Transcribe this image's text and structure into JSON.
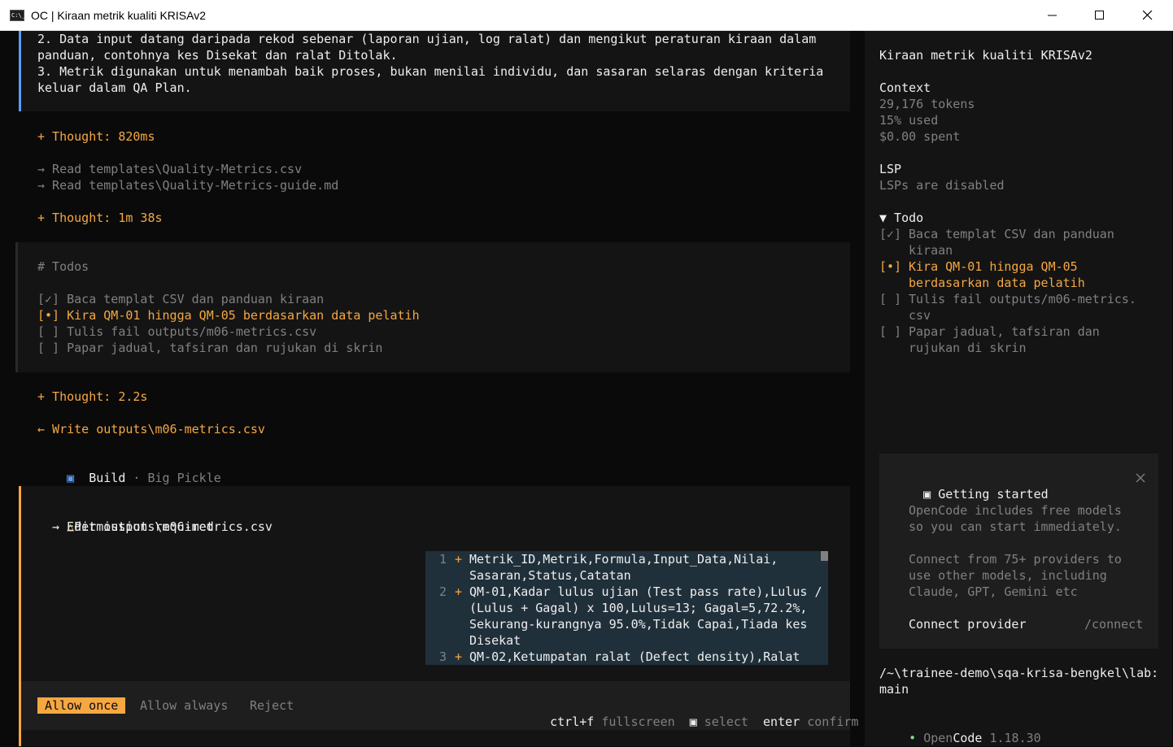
{
  "window": {
    "icon_text": "C:\\_",
    "title": "OC | Kiraan metrik kualiti KRISAv2"
  },
  "main": {
    "intro_lines": [
      "2. Data input datang daripada rekod sebenar (laporan ujian, log ralat) dan mengikut peraturan kiraan dalam",
      "panduan, contohnya kes Disekat dan ralat Ditolak.",
      "3. Metrik digunakan untuk menambah baik proses, bukan menilai individu, dan sasaran selaras dengan kriteria",
      "keluar dalam QA Plan."
    ],
    "thought_1": "+ Thought: 820ms",
    "reads": [
      "→ Read templates\\Quality-Metrics.csv",
      "→ Read templates\\Quality-Metrics-guide.md"
    ],
    "thought_2": "+ Thought: 1m 38s",
    "todos_header": "# Todos",
    "todos": [
      {
        "text": "[✓] Baca templat CSV dan panduan kiraan",
        "state": "done"
      },
      {
        "text": "[•] Kira QM-01 hingga QM-05 berdasarkan data pelatih",
        "state": "active"
      },
      {
        "text": "[ ] Tulis fail outputs/m06-metrics.csv",
        "state": "pending"
      },
      {
        "text": "[ ] Papar jadual, tafsiran dan rujukan di skrin",
        "state": "pending"
      }
    ],
    "thought_3": "+ Thought: 2.2s",
    "write": "← Write outputs\\m06-metrics.csv",
    "build": {
      "icon": "▣",
      "label": "Build",
      "separator": "·",
      "model": "Big Pickle"
    },
    "permission": {
      "icon": "△",
      "title": "Permission required",
      "action": "→ Edit outputs\\m06-metrics.csv"
    },
    "diff_lines": [
      {
        "num": "1",
        "sign": "+",
        "text": "Metrik_ID,Metrik,Formula,Input_Data,Nilai,"
      },
      {
        "num": "",
        "sign": "",
        "text": "Sasaran,Status,Catatan"
      },
      {
        "num": "2",
        "sign": "+",
        "text": "QM-01,Kadar lulus ujian (Test pass rate),Lulus /"
      },
      {
        "num": "",
        "sign": "",
        "text": "(Lulus + Gagal) x 100,Lulus=13; Gagal=5,72.2%,"
      },
      {
        "num": "",
        "sign": "",
        "text": "Sekurang-kurangnya 95.0%,Tidak Capai,Tiada kes"
      },
      {
        "num": "",
        "sign": "",
        "text": "Disekat"
      },
      {
        "num": "3",
        "sign": "+",
        "text": "QM-02,Ketumpatan ralat (Defect density),Ralat"
      }
    ],
    "actions": {
      "allow_once": "Allow once",
      "allow_always": "Allow always",
      "reject": "Reject"
    },
    "hints": {
      "fullscreen_key": "ctrl+f",
      "fullscreen": "fullscreen",
      "select_key": "▣",
      "select": "select",
      "confirm_key": "enter",
      "confirm": "confirm"
    }
  },
  "sidebar": {
    "title": "Kiraan metrik kualiti KRISAv2",
    "context_header": "Context",
    "tokens": "29,176 tokens",
    "used": "15% used",
    "spent": "$0.00 spent",
    "lsp_header": "LSP",
    "lsp_status": "LSPs are disabled",
    "todo_header": "▼ Todo",
    "todos": [
      {
        "mark": "[✓]",
        "line1": "Baca templat CSV dan panduan",
        "line2": "kiraan",
        "state": "done"
      },
      {
        "mark": "[•]",
        "line1": "Kira QM-01 hingga QM-05",
        "line2": "berdasarkan data pelatih",
        "state": "active"
      },
      {
        "mark": "[ ]",
        "line1": "Tulis fail outputs/m06-metrics.",
        "line2": "csv",
        "state": "pending"
      },
      {
        "mark": "[ ]",
        "line1": "Papar jadual, tafsiran dan",
        "line2": "rujukan di skrin",
        "state": "pending"
      }
    ],
    "getting_started": {
      "icon": "▣",
      "title": "Getting started",
      "p1": [
        "OpenCode includes free models",
        "so you can start immediately."
      ],
      "p2": [
        "Connect from 75+ providers to",
        "use other models, including",
        "Claude, GPT, Gemini etc"
      ],
      "connect_label": "Connect provider",
      "connect_cmd": "/connect"
    },
    "path_line1": "/~\\trainee-demo\\sqa-krisa-bengkel\\lab:",
    "path_line2": "main",
    "version": {
      "dot": "•",
      "open": "Open",
      "code": "Code",
      "number": "1.18.30"
    }
  },
  "colors": {
    "accent": "#f5a742",
    "blue_bar": "#5c9cf5",
    "diff_bg": "#20303b",
    "panel_bg": "#141414"
  }
}
